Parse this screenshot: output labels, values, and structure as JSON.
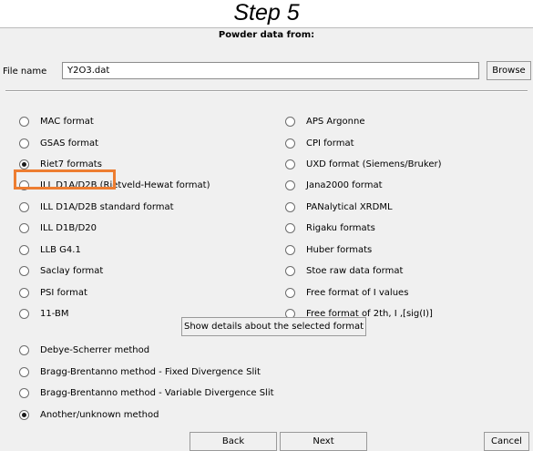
{
  "caption": "Step 5",
  "dialog": {
    "title": "Powder data from:",
    "file": {
      "label": "File name",
      "value": "Y2O3.dat",
      "browse_label": "Browse"
    },
    "formats_left": [
      {
        "label": "MAC format",
        "selected": false
      },
      {
        "label": "GSAS format",
        "selected": false
      },
      {
        "label": "Riet7 formats",
        "selected": true
      },
      {
        "label": "ILL D1A/D2B (Rietveld-Hewat format)",
        "selected": false
      },
      {
        "label": "ILL D1A/D2B standard format",
        "selected": false
      },
      {
        "label": "ILL D1B/D20",
        "selected": false
      },
      {
        "label": "LLB G4.1",
        "selected": false
      },
      {
        "label": "Saclay format",
        "selected": false
      },
      {
        "label": "PSI format",
        "selected": false
      },
      {
        "label": "11-BM",
        "selected": false
      }
    ],
    "formats_right": [
      {
        "label": "APS Argonne",
        "selected": false
      },
      {
        "label": "CPI format",
        "selected": false
      },
      {
        "label": "UXD format (Siemens/Bruker)",
        "selected": false
      },
      {
        "label": "Jana2000 format",
        "selected": false
      },
      {
        "label": "PANalytical XRDML",
        "selected": false
      },
      {
        "label": "Rigaku formats",
        "selected": false
      },
      {
        "label": "Huber formats",
        "selected": false
      },
      {
        "label": "Stoe raw data format",
        "selected": false
      },
      {
        "label": "Free format of I values",
        "selected": false
      },
      {
        "label": "Free format of 2th, I ,[sig(I)]",
        "selected": false
      }
    ],
    "details_button": "Show details about the selected format",
    "methods": [
      {
        "label": "Debye-Scherrer method",
        "selected": false
      },
      {
        "label": "Bragg-Brentanno method - Fixed Divergence Slit",
        "selected": false
      },
      {
        "label": "Bragg-Brentanno method - Variable Divergence Slit",
        "selected": false
      },
      {
        "label": "Another/unknown method",
        "selected": true
      }
    ],
    "buttons": {
      "back": "Back",
      "next": "Next",
      "cancel": "Cancel"
    },
    "highlight_color": "#ed7d31"
  }
}
